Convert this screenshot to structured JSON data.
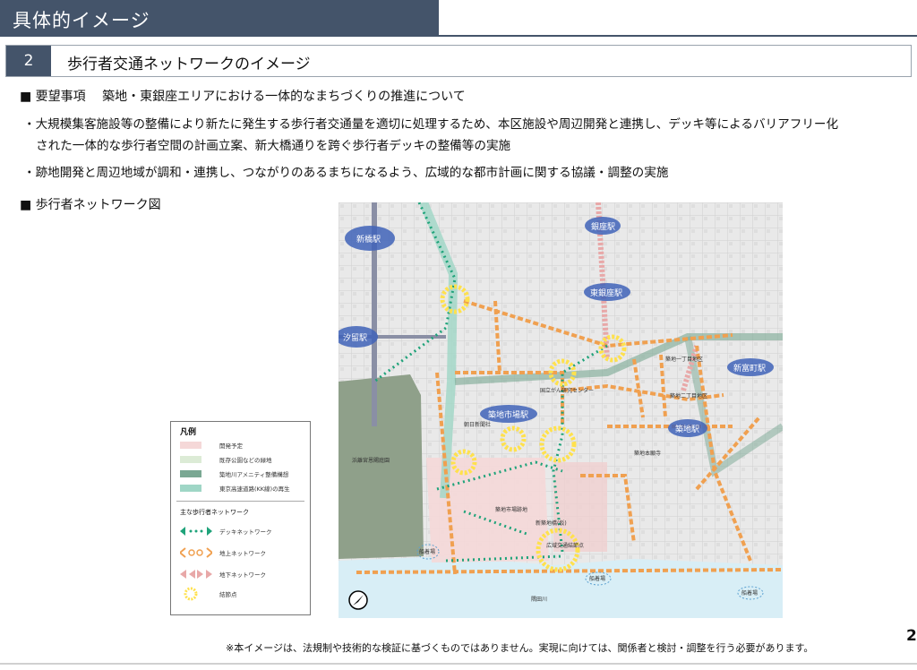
{
  "header": {
    "title": "具体的イメージ"
  },
  "section": {
    "number": "2",
    "title": "歩行者交通ネットワークのイメージ"
  },
  "request": {
    "heading": "■ 要望事項　 築地・東銀座エリアにおける一体的なまちづくりの推進について",
    "bullet1_line1": "・大規模集客施設等の整備により新たに発生する歩行者交通量を適切に処理するため、本区施設や周辺開発と連携し、デッキ等によるバリアフリー化",
    "bullet1_line2": "された一体的な歩行者空間の計画立案、新大橋通りを跨ぐ歩行者デッキの整備等の実施",
    "bullet2": "・跡地開発と周辺地域が調和・連携し、つながりのあるまちになるよう、広域的な都市計画に関する協議・調整の実施"
  },
  "network": {
    "heading": "■ 歩行者ネットワーク図"
  },
  "map": {
    "stations": [
      "新橋駅",
      "汐留駅",
      "銀座駅",
      "東銀座駅",
      "築地市場駅",
      "築地駅",
      "新富町駅"
    ],
    "labels": {
      "hamarikyu": "浜離宮恩賜庭園",
      "market_site": "築地市場跡地",
      "cancer_center": "国立がん研究センター",
      "asahi": "朝日新聞社",
      "honganji": "築地本願寺",
      "district1": "築地一丁目地区",
      "district2": "築地二丁目地区",
      "new_bridge": "新築地橋(仮)",
      "hub": "広域交通結節点",
      "sumida": "隅田川",
      "pier_left": "船着場",
      "pier_mid": "船着場",
      "pier_right": "船着場"
    },
    "colors": {
      "deck": "#1fa37a",
      "ground": "#f0a050",
      "underground": "#e8a8a8",
      "node": "#ffe14d",
      "station": "#3f63b8"
    }
  },
  "legend": {
    "title": "凡例",
    "items": [
      "開発予定",
      "既存公園などの緑地",
      "築地川アメニティ整備構想",
      "東京高速道路(KK線)の再生"
    ],
    "network_title": "主な歩行者ネットワーク",
    "network_items": [
      "デッキネットワーク",
      "地上ネットワーク",
      "地下ネットワーク",
      "結節点"
    ]
  },
  "footer": {
    "note": "※本イメージは、法規制や技術的な検証に基づくものではありません。実現に向けては、関係者と検討・調整を行う必要があります。"
  },
  "page": {
    "number": "2"
  }
}
